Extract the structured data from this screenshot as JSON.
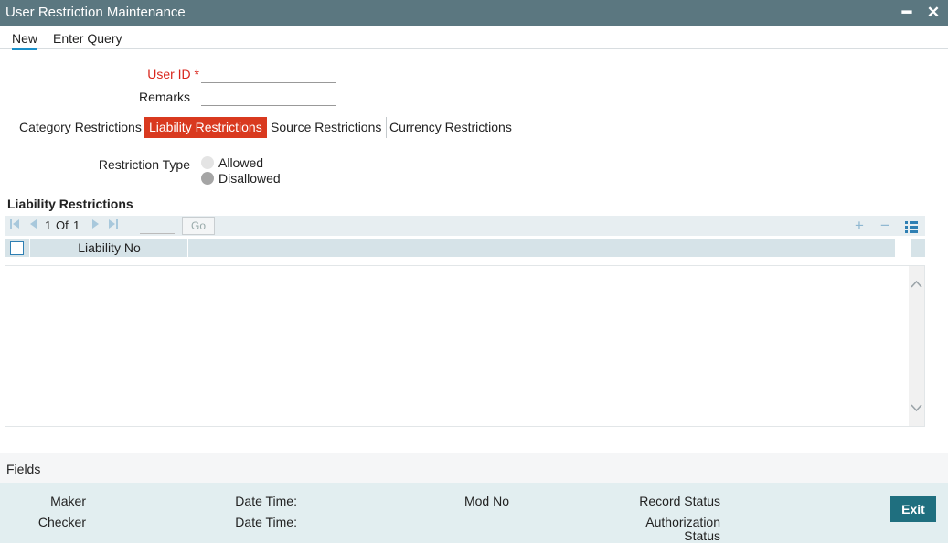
{
  "window": {
    "title": "User Restriction Maintenance",
    "minimize_glyph": "━",
    "close_glyph": "✕"
  },
  "menu": {
    "items": [
      "New",
      "Enter Query"
    ],
    "active": "New"
  },
  "form": {
    "user_id_label": "User ID",
    "required_marker": "*",
    "user_id_value": "",
    "remarks_label": "Remarks",
    "remarks_value": ""
  },
  "tabs": [
    {
      "label": "Category Restrictions"
    },
    {
      "label": "Liability Restrictions"
    },
    {
      "label": "Source Restrictions"
    },
    {
      "label": "Currency Restrictions"
    }
  ],
  "active_tab": "Liability Restrictions",
  "restriction": {
    "label": "Restriction Type",
    "options": [
      "Allowed",
      "Disallowed"
    ],
    "selected": "Disallowed"
  },
  "grid": {
    "section_title": "Liability Restrictions",
    "pagination": {
      "current": "1",
      "of_label": "Of",
      "total": "1",
      "go_label": "Go"
    },
    "columns": [
      "Liability No"
    ],
    "rows": [],
    "toolbar_icons": [
      "add-row-icon",
      "delete-row-icon",
      "single-view-icon"
    ]
  },
  "footer": {
    "fields_label": "Fields",
    "maker_label": "Maker",
    "checker_label": "Checker",
    "date_time_label": "Date Time:",
    "mod_no_label": "Mod No",
    "record_status_label": "Record Status",
    "auth_status_label_line1": "Authorization",
    "auth_status_label_line2": "Status",
    "exit_label": "Exit"
  },
  "colors": {
    "title_bar": "#5b7780",
    "active_tab": "#d9391f",
    "required": "#d9261c",
    "accent_underline": "#1a8fc9",
    "exit_button": "#1f6f7f"
  }
}
